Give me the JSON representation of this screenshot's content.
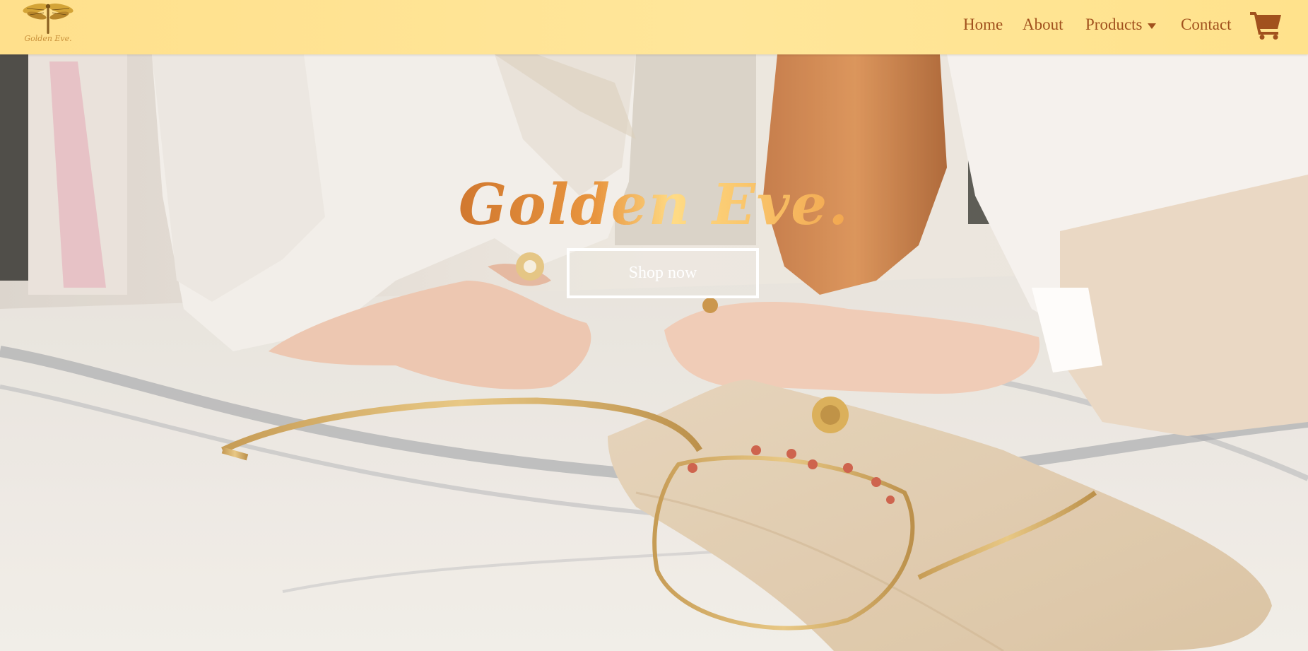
{
  "brand": {
    "logo_text": "Golden Eve.",
    "logo_icon": "dragonfly-icon"
  },
  "nav": {
    "items": [
      {
        "label": "Home"
      },
      {
        "label": "About"
      },
      {
        "label": "Products",
        "icon": "caret-down-icon"
      },
      {
        "label": "Contact"
      }
    ],
    "cart_icon": "shopping-cart-icon"
  },
  "hero": {
    "title": "Golden Eve.",
    "cta_label": "Shop now",
    "image_description_icon": "jewelry-photo"
  },
  "colors": {
    "navbar_bg": "#ffe594",
    "nav_text": "#a1511d",
    "title_gradient_start": "#d1782f",
    "title_gradient_end": "#ffdb85",
    "cta_border": "#ffffff"
  }
}
